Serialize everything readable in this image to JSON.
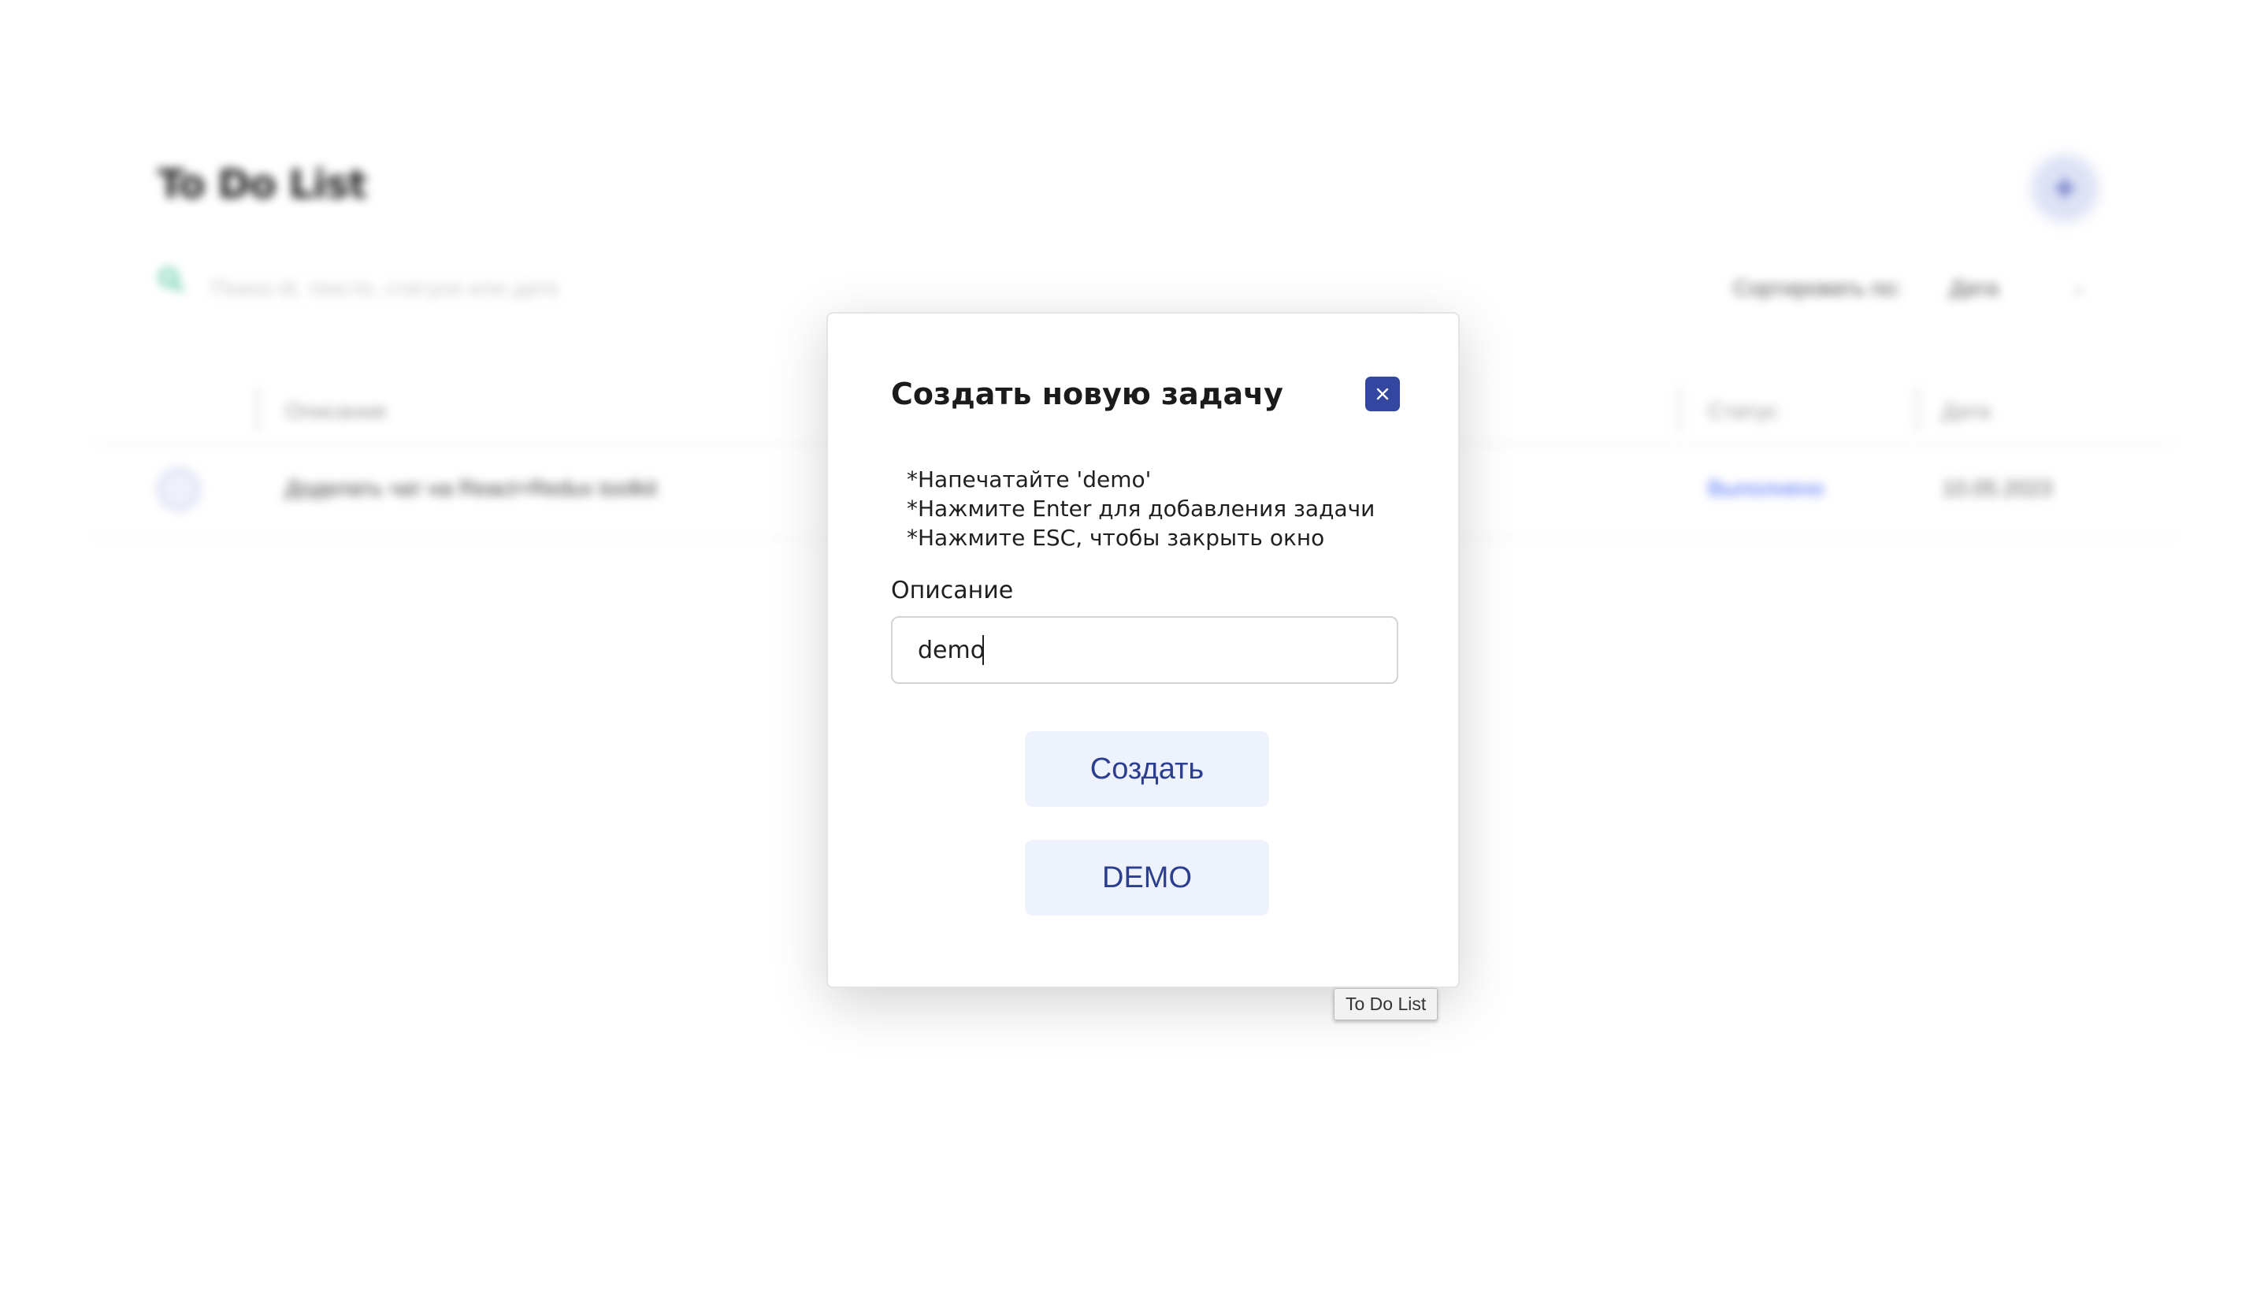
{
  "background": {
    "app_title": "To Do List",
    "search_placeholder": "Поиск id, тексте, статусе или дате",
    "sort_label": "Сортировать по:",
    "sort_value": "Дата",
    "columns": [
      "Описание",
      "Статус",
      "Дата"
    ],
    "rows": [
      {
        "description": "Доделать чат на React+Redux toolkit",
        "status": "Выполнено",
        "date": "10.05.2023"
      }
    ]
  },
  "modal": {
    "title": "Создать новую задачу",
    "close_label": "×",
    "hints": [
      "*Напечатайте 'demo'",
      "*Нажмите Enter для добавления задачи",
      "*Нажмите ESC, чтобы закрыть окно"
    ],
    "field_label": "Описание",
    "field_value": "demo",
    "create_label": "Создать",
    "demo_label": "DEMO"
  },
  "tooltip": "To Do List",
  "colors": {
    "accent": "#3346a0",
    "button_bg": "#eef2fd",
    "button_text": "#2c3e8e",
    "status_done": "#4a6cf7"
  }
}
